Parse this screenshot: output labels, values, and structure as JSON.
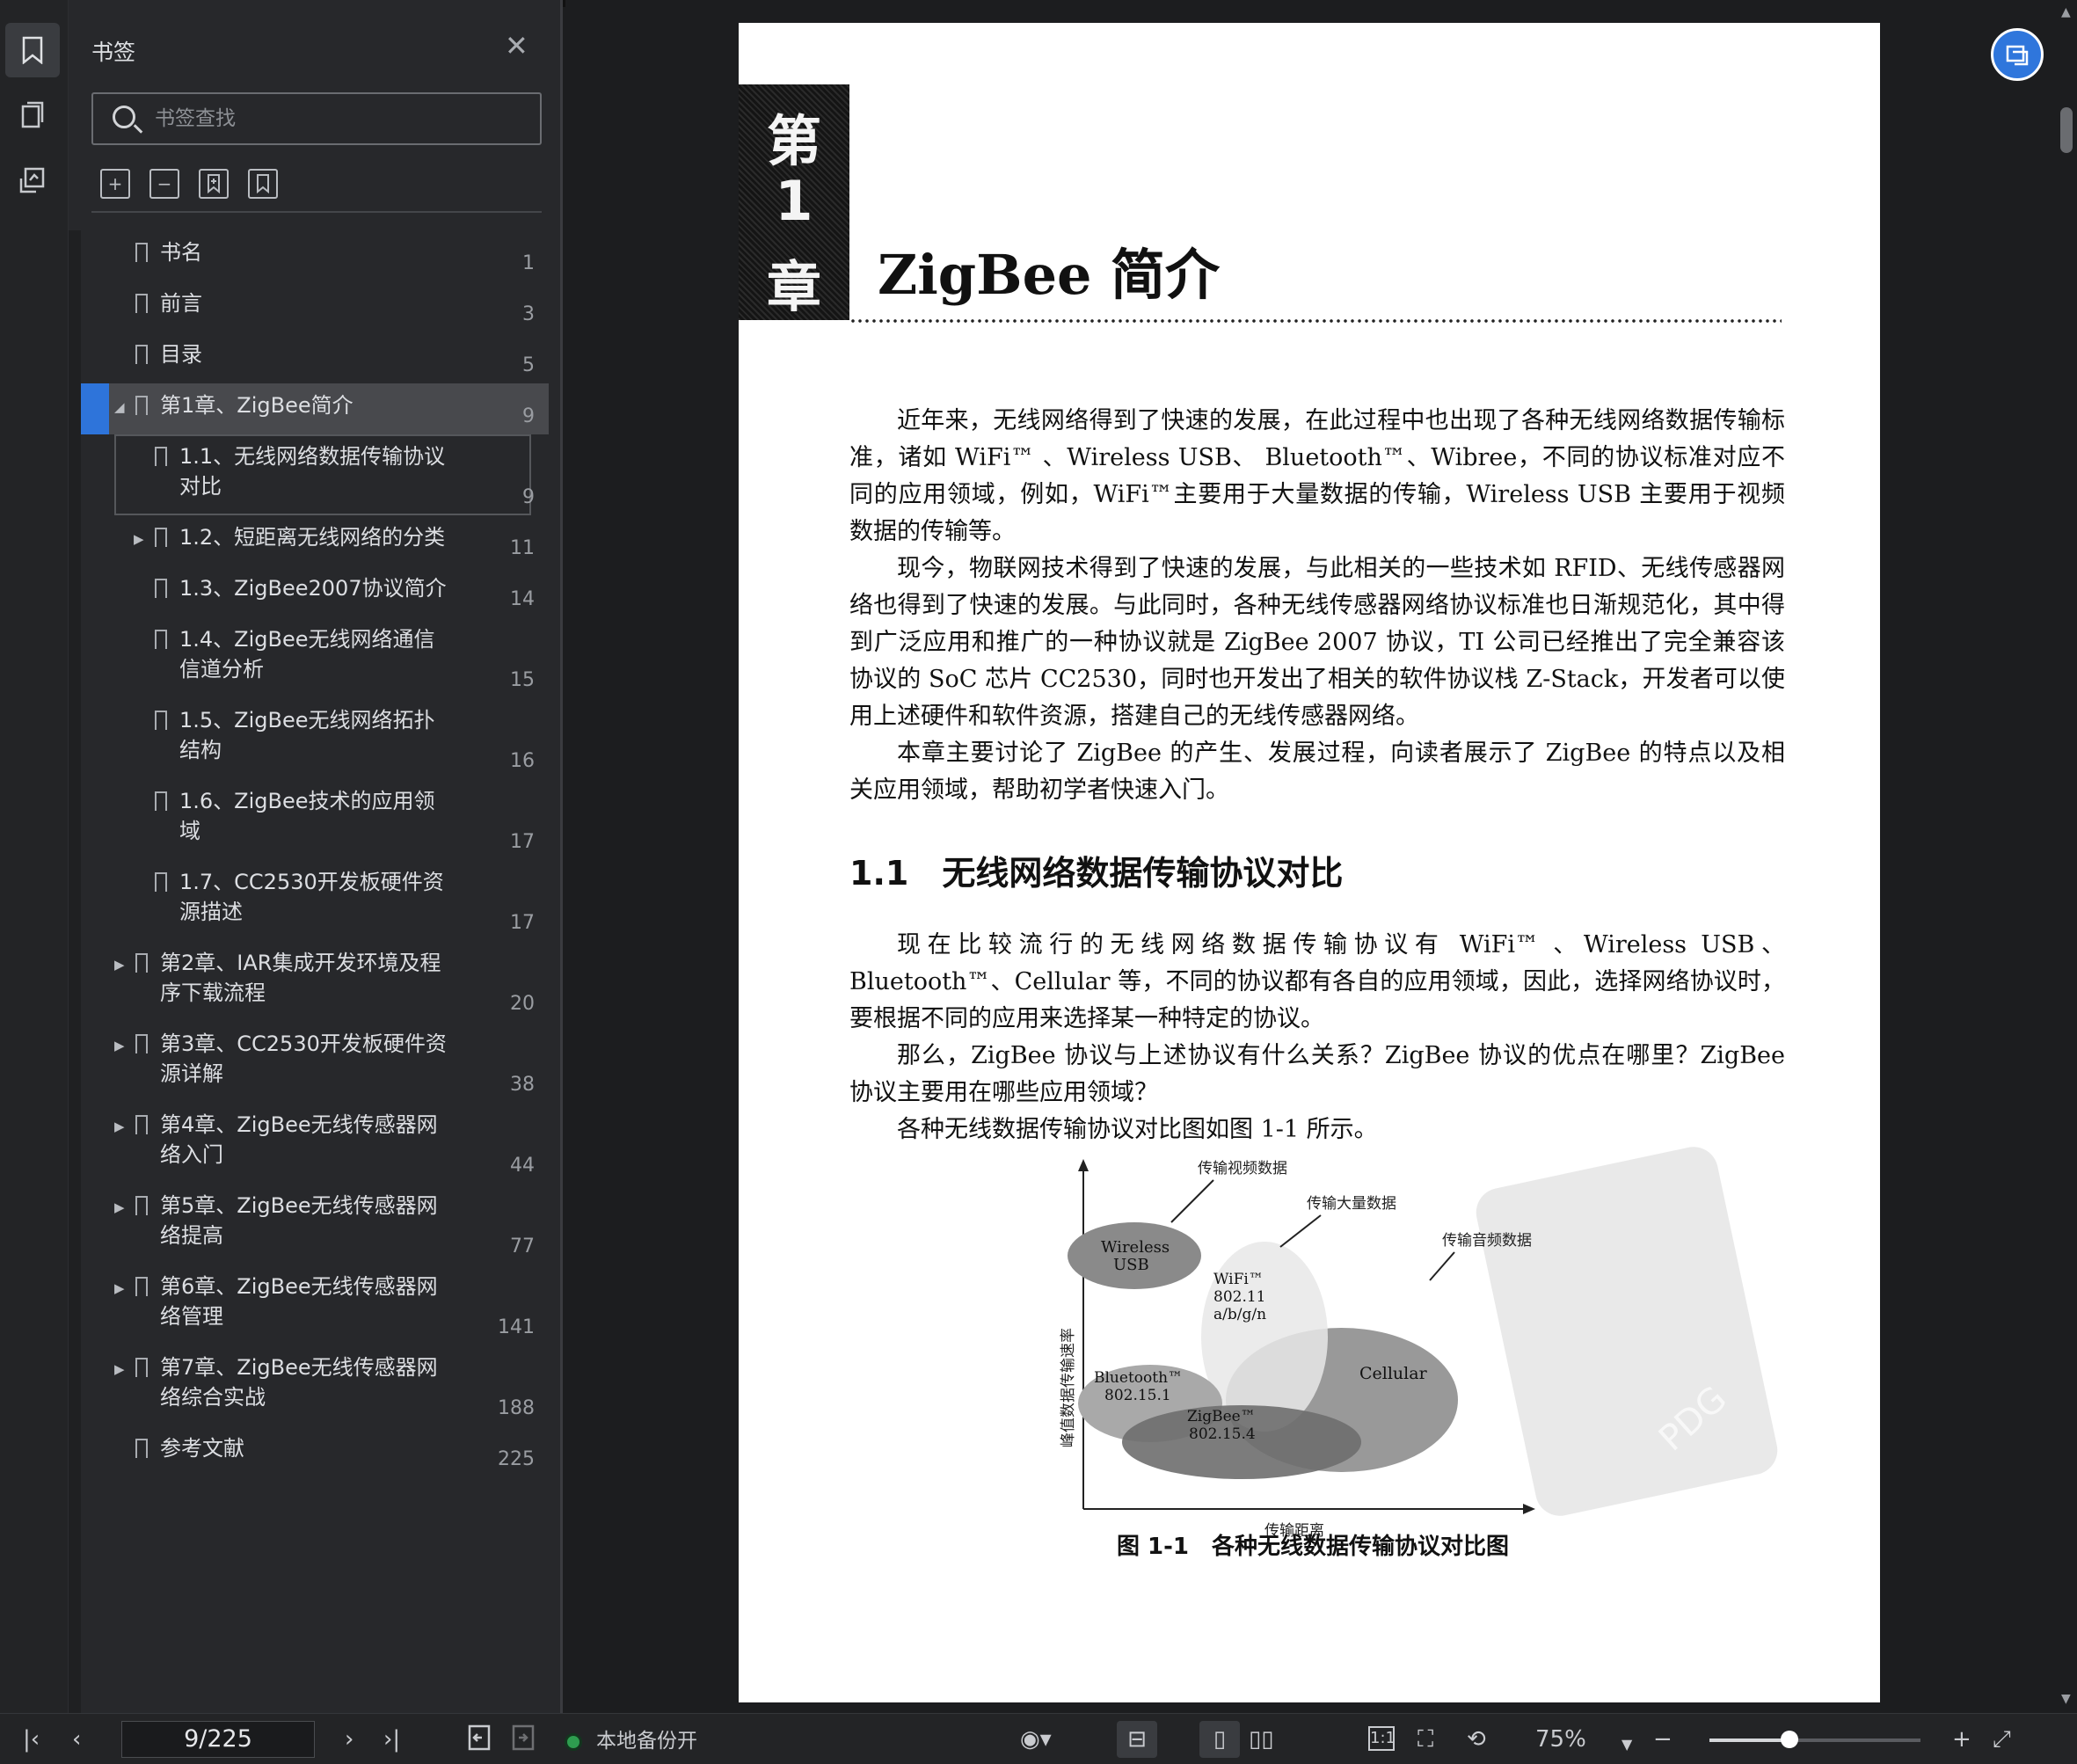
{
  "sidebar": {
    "title": "书签",
    "search_placeholder": "书签查找",
    "items": [
      {
        "label": "书名",
        "page": "1",
        "indent": 0,
        "expander": ""
      },
      {
        "label": "前言",
        "page": "3",
        "indent": 0,
        "expander": ""
      },
      {
        "label": "目录",
        "page": "5",
        "indent": 0,
        "expander": ""
      },
      {
        "label": "第1章、ZigBee简介",
        "page": "9",
        "indent": 0,
        "expander": "expanded"
      },
      {
        "label": "1.1、无线网络数据传输协议\n对比",
        "page": "9",
        "indent": 1,
        "expander": ""
      },
      {
        "label": "1.2、短距离无线网络的分类",
        "page": "11",
        "indent": 1,
        "expander": "collapsed"
      },
      {
        "label": "1.3、ZigBee2007协议简介",
        "page": "14",
        "indent": 1,
        "expander": ""
      },
      {
        "label": "1.4、ZigBee无线网络通信\n信道分析",
        "page": "15",
        "indent": 1,
        "expander": ""
      },
      {
        "label": "1.5、ZigBee无线网络拓扑\n结构",
        "page": "16",
        "indent": 1,
        "expander": ""
      },
      {
        "label": "1.6、ZigBee技术的应用领\n域",
        "page": "17",
        "indent": 1,
        "expander": ""
      },
      {
        "label": "1.7、CC2530开发板硬件资\n源描述",
        "page": "17",
        "indent": 1,
        "expander": ""
      },
      {
        "label": "第2章、IAR集成开发环境及程\n序下载流程",
        "page": "20",
        "indent": 0,
        "expander": "collapsed"
      },
      {
        "label": "第3章、CC2530开发板硬件资\n源详解",
        "page": "38",
        "indent": 0,
        "expander": "collapsed"
      },
      {
        "label": "第4章、ZigBee无线传感器网\n络入门",
        "page": "44",
        "indent": 0,
        "expander": "collapsed"
      },
      {
        "label": "第5章、ZigBee无线传感器网\n络提高",
        "page": "77",
        "indent": 0,
        "expander": "collapsed"
      },
      {
        "label": "第6章、ZigBee无线传感器网\n络管理",
        "page": "141",
        "indent": 0,
        "expander": "collapsed"
      },
      {
        "label": "第7章、ZigBee无线传感器网\n络综合实战",
        "page": "188",
        "indent": 0,
        "expander": "collapsed"
      },
      {
        "label": "参考文献",
        "page": "225",
        "indent": 0,
        "expander": ""
      }
    ],
    "active_index": 3,
    "framed_index": 4
  },
  "document": {
    "chapter_chars": [
      "第",
      "1",
      "章"
    ],
    "chapter_title": "ZigBee 简介",
    "paragraphs_1": [
      "近年来，无线网络得到了快速的发展，在此过程中也出现了各种无线网络数据传输标准，诸如 WiFi™ 、Wireless USB、 Bluetooth™、Wibree，不同的协议标准对应不同的应用领域，例如，WiFi™主要用于大量数据的传输，Wireless USB 主要用于视频数据的传输等。",
      "现今，物联网技术得到了快速的发展，与此相关的一些技术如 RFID、无线传感器网络也得到了快速的发展。与此同时，各种无线传感器网络协议标准也日渐规范化，其中得到广泛应用和推广的一种协议就是 ZigBee 2007 协议，TI 公司已经推出了完全兼容该协议的 SoC 芯片 CC2530，同时也开发出了相关的软件协议栈 Z-Stack，开发者可以使用上述硬件和软件资源，搭建自己的无线传感器网络。",
      "本章主要讨论了 ZigBee 的产生、发展过程，向读者展示了 ZigBee 的特点以及相关应用领域，帮助初学者快速入门。"
    ],
    "section_title": "1.1　无线网络数据传输协议对比",
    "paragraphs_2": [
      "现在比较流行的无线网络数据传输协议有 WiFi™ 、Wireless USB、Bluetooth™、Cellular 等，不同的协议都有各自的应用领域，因此，选择网络协议时，要根据不同的应用来选择某一种特定的协议。",
      "那么，ZigBee 协议与上述协议有什么关系？ZigBee 协议的优点在哪里？ZigBee 协议主要用在哪些应用领域？",
      "各种无线数据传输协议对比图如图 1-1 所示。"
    ],
    "figure": {
      "y_axis": "峰值数据传输速率",
      "x_axis": "传输距离",
      "callout_video": "传输视频数据",
      "callout_bulk": "传输大量数据",
      "callout_audio": "传输音频数据",
      "wusb": [
        "Wireless",
        "USB"
      ],
      "wifi": [
        "WiFi™",
        "802.11",
        "a/b/g/n"
      ],
      "cellular": "Cellular",
      "bluetooth": [
        "Bluetooth™",
        "802.15.1"
      ],
      "zigbee": [
        "ZigBee™",
        "802.15.4"
      ]
    },
    "figure_caption": "图 1-1　各种无线数据传输协议对比图",
    "watermark": "PDG"
  },
  "statusbar": {
    "page_indicator": "9/225",
    "backup_label": "本地备份开",
    "zoom": "75%",
    "zoom_fraction": 0.38
  }
}
